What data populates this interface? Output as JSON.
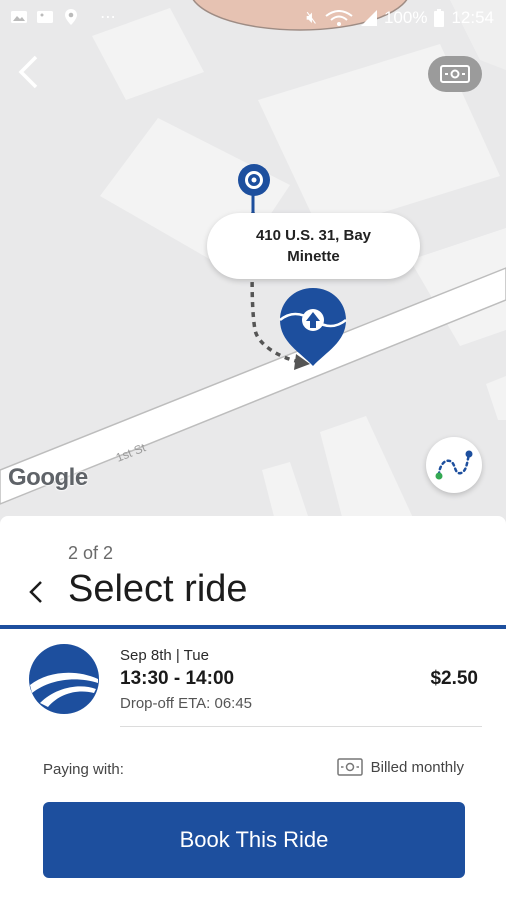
{
  "status_bar": {
    "battery": "100%",
    "time": "12:54"
  },
  "map": {
    "address": "410 U.S. 31, Bay Minette",
    "street_label": "1st St",
    "attribution": "Google"
  },
  "sheet": {
    "step": "2 of 2",
    "title": "Select ride",
    "ride": {
      "date": "Sep 8th | Tue",
      "time_window": "13:30 - 14:00",
      "dropoff_eta": "Drop-off ETA: 06:45",
      "price": "$2.50"
    },
    "paying_label": "Paying with:",
    "payment_method": "Billed monthly",
    "book_button": "Book This Ride"
  },
  "colors": {
    "primary": "#1d4f9e",
    "map_bg": "#e9e9ea",
    "building": "#f3f3f3"
  }
}
